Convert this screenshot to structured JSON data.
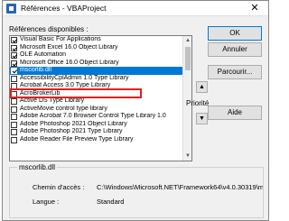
{
  "window": {
    "title": "Références - VBAProject",
    "close_glyph": "✕"
  },
  "references_label": "Références disponibles :",
  "list_items": [
    {
      "label": "Visual Basic For Applications",
      "checked": true,
      "selected": false
    },
    {
      "label": "Microsoft Excel 16.0 Object Library",
      "checked": true,
      "selected": false
    },
    {
      "label": "OLE Automation",
      "checked": true,
      "selected": false
    },
    {
      "label": "Microsoft Office 16.0 Object Library",
      "checked": true,
      "selected": false
    },
    {
      "label": "mscorlib.dll",
      "checked": true,
      "selected": true
    },
    {
      "label": "AccessibilityCplAdmin 1.0 Type Library",
      "checked": false,
      "selected": false
    },
    {
      "label": "Acrobat Access 3.0 Type Library",
      "checked": false,
      "selected": false
    },
    {
      "label": "AcroBrokerLib",
      "checked": false,
      "selected": false
    },
    {
      "label": "Active DS Type Library",
      "checked": false,
      "selected": false
    },
    {
      "label": "ActiveMovie control type library",
      "checked": false,
      "selected": false
    },
    {
      "label": "Adobe Acrobat 7.0 Browser Control Type Library 1.0",
      "checked": false,
      "selected": false
    },
    {
      "label": "Adobe Photoshop 2021 Object Library",
      "checked": false,
      "selected": false
    },
    {
      "label": "Adobe Photoshop 2021 Type Library",
      "checked": false,
      "selected": false
    },
    {
      "label": "Adobe Reader File Preview Type Library",
      "checked": false,
      "selected": false
    }
  ],
  "buttons": {
    "ok": "OK",
    "annuler": "Annuler",
    "parcourir": "Parcourir...",
    "aide": "Aide"
  },
  "priority": {
    "label": "Priorité",
    "up_glyph": "▲",
    "down_glyph": "▼"
  },
  "details": {
    "group_title": "mscorlib.dll",
    "path_label": "Chemin d'accès :",
    "path_value": "C:\\Windows\\Microsoft.NET\\Framework64\\v4.0.30319\\m",
    "language_label": "Langue :",
    "language_value": "Standard"
  },
  "colors": {
    "selection": "#0078d7",
    "highlight_box": "#e02020",
    "accent": "#0078d7"
  }
}
